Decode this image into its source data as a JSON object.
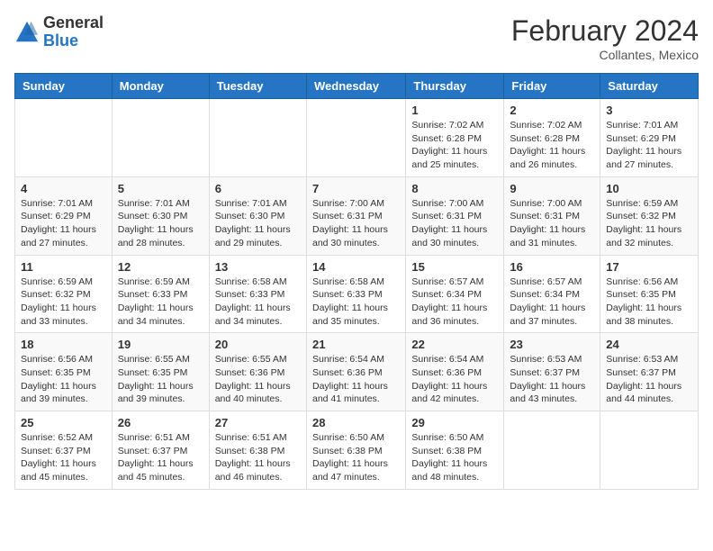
{
  "header": {
    "logo_general": "General",
    "logo_blue": "Blue",
    "month_year": "February 2024",
    "location": "Collantes, Mexico"
  },
  "days_of_week": [
    "Sunday",
    "Monday",
    "Tuesday",
    "Wednesday",
    "Thursday",
    "Friday",
    "Saturday"
  ],
  "weeks": [
    [
      {
        "day": "",
        "info": ""
      },
      {
        "day": "",
        "info": ""
      },
      {
        "day": "",
        "info": ""
      },
      {
        "day": "",
        "info": ""
      },
      {
        "day": "1",
        "info": "Sunrise: 7:02 AM\nSunset: 6:28 PM\nDaylight: 11 hours and 25 minutes."
      },
      {
        "day": "2",
        "info": "Sunrise: 7:02 AM\nSunset: 6:28 PM\nDaylight: 11 hours and 26 minutes."
      },
      {
        "day": "3",
        "info": "Sunrise: 7:01 AM\nSunset: 6:29 PM\nDaylight: 11 hours and 27 minutes."
      }
    ],
    [
      {
        "day": "4",
        "info": "Sunrise: 7:01 AM\nSunset: 6:29 PM\nDaylight: 11 hours and 27 minutes."
      },
      {
        "day": "5",
        "info": "Sunrise: 7:01 AM\nSunset: 6:30 PM\nDaylight: 11 hours and 28 minutes."
      },
      {
        "day": "6",
        "info": "Sunrise: 7:01 AM\nSunset: 6:30 PM\nDaylight: 11 hours and 29 minutes."
      },
      {
        "day": "7",
        "info": "Sunrise: 7:00 AM\nSunset: 6:31 PM\nDaylight: 11 hours and 30 minutes."
      },
      {
        "day": "8",
        "info": "Sunrise: 7:00 AM\nSunset: 6:31 PM\nDaylight: 11 hours and 30 minutes."
      },
      {
        "day": "9",
        "info": "Sunrise: 7:00 AM\nSunset: 6:31 PM\nDaylight: 11 hours and 31 minutes."
      },
      {
        "day": "10",
        "info": "Sunrise: 6:59 AM\nSunset: 6:32 PM\nDaylight: 11 hours and 32 minutes."
      }
    ],
    [
      {
        "day": "11",
        "info": "Sunrise: 6:59 AM\nSunset: 6:32 PM\nDaylight: 11 hours and 33 minutes."
      },
      {
        "day": "12",
        "info": "Sunrise: 6:59 AM\nSunset: 6:33 PM\nDaylight: 11 hours and 34 minutes."
      },
      {
        "day": "13",
        "info": "Sunrise: 6:58 AM\nSunset: 6:33 PM\nDaylight: 11 hours and 34 minutes."
      },
      {
        "day": "14",
        "info": "Sunrise: 6:58 AM\nSunset: 6:33 PM\nDaylight: 11 hours and 35 minutes."
      },
      {
        "day": "15",
        "info": "Sunrise: 6:57 AM\nSunset: 6:34 PM\nDaylight: 11 hours and 36 minutes."
      },
      {
        "day": "16",
        "info": "Sunrise: 6:57 AM\nSunset: 6:34 PM\nDaylight: 11 hours and 37 minutes."
      },
      {
        "day": "17",
        "info": "Sunrise: 6:56 AM\nSunset: 6:35 PM\nDaylight: 11 hours and 38 minutes."
      }
    ],
    [
      {
        "day": "18",
        "info": "Sunrise: 6:56 AM\nSunset: 6:35 PM\nDaylight: 11 hours and 39 minutes."
      },
      {
        "day": "19",
        "info": "Sunrise: 6:55 AM\nSunset: 6:35 PM\nDaylight: 11 hours and 39 minutes."
      },
      {
        "day": "20",
        "info": "Sunrise: 6:55 AM\nSunset: 6:36 PM\nDaylight: 11 hours and 40 minutes."
      },
      {
        "day": "21",
        "info": "Sunrise: 6:54 AM\nSunset: 6:36 PM\nDaylight: 11 hours and 41 minutes."
      },
      {
        "day": "22",
        "info": "Sunrise: 6:54 AM\nSunset: 6:36 PM\nDaylight: 11 hours and 42 minutes."
      },
      {
        "day": "23",
        "info": "Sunrise: 6:53 AM\nSunset: 6:37 PM\nDaylight: 11 hours and 43 minutes."
      },
      {
        "day": "24",
        "info": "Sunrise: 6:53 AM\nSunset: 6:37 PM\nDaylight: 11 hours and 44 minutes."
      }
    ],
    [
      {
        "day": "25",
        "info": "Sunrise: 6:52 AM\nSunset: 6:37 PM\nDaylight: 11 hours and 45 minutes."
      },
      {
        "day": "26",
        "info": "Sunrise: 6:51 AM\nSunset: 6:37 PM\nDaylight: 11 hours and 45 minutes."
      },
      {
        "day": "27",
        "info": "Sunrise: 6:51 AM\nSunset: 6:38 PM\nDaylight: 11 hours and 46 minutes."
      },
      {
        "day": "28",
        "info": "Sunrise: 6:50 AM\nSunset: 6:38 PM\nDaylight: 11 hours and 47 minutes."
      },
      {
        "day": "29",
        "info": "Sunrise: 6:50 AM\nSunset: 6:38 PM\nDaylight: 11 hours and 48 minutes."
      },
      {
        "day": "",
        "info": ""
      },
      {
        "day": "",
        "info": ""
      }
    ]
  ]
}
